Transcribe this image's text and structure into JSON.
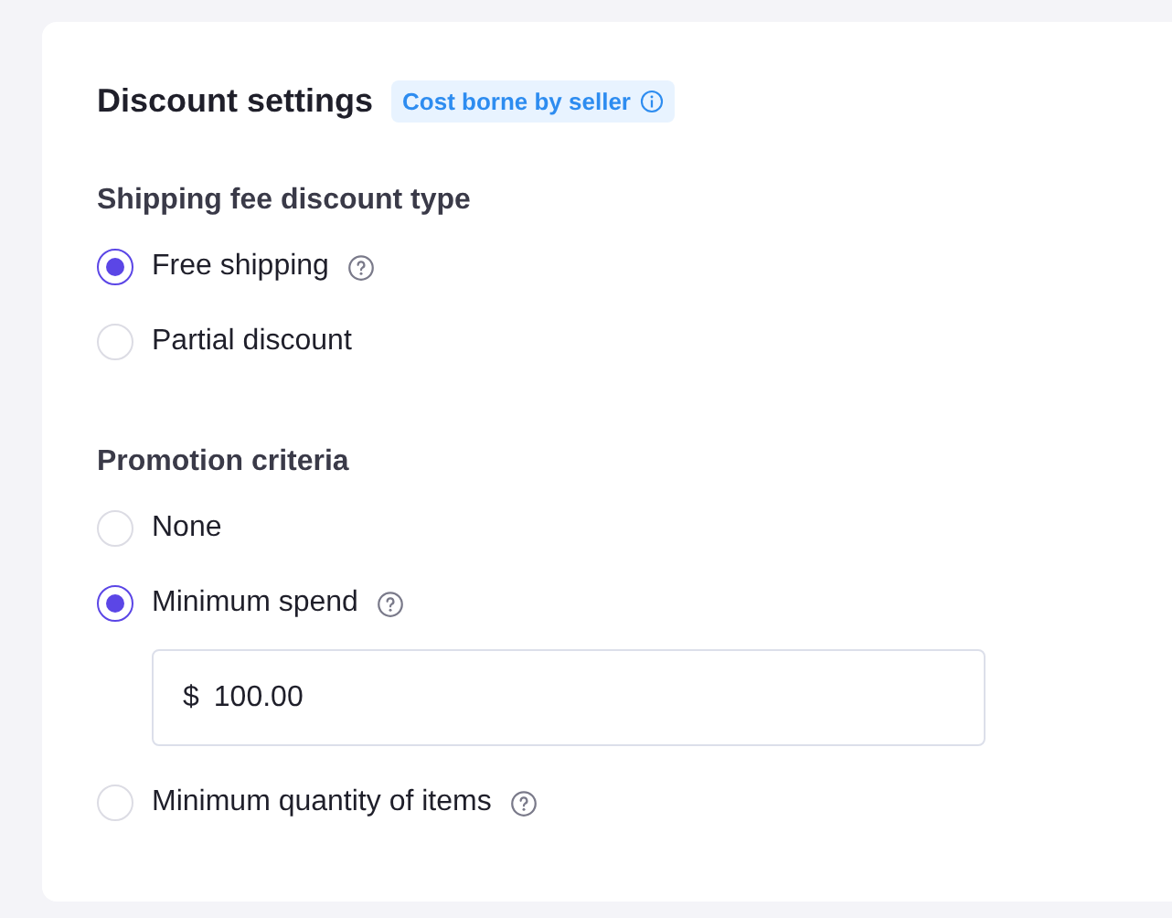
{
  "title": "Discount settings",
  "badge": {
    "label": "Cost borne by seller"
  },
  "sections": [
    {
      "title": "Shipping fee discount type",
      "options": [
        {
          "label": "Free shipping",
          "selected": true,
          "help": true
        },
        {
          "label": "Partial discount",
          "selected": false,
          "help": false
        }
      ]
    },
    {
      "title": "Promotion criteria",
      "options": [
        {
          "label": "None",
          "selected": false,
          "help": false
        },
        {
          "label": "Minimum spend",
          "selected": true,
          "help": true,
          "field": {
            "prefix": "$",
            "value": "100.00"
          }
        },
        {
          "label": "Minimum quantity of items",
          "selected": false,
          "help": true
        }
      ]
    }
  ]
}
